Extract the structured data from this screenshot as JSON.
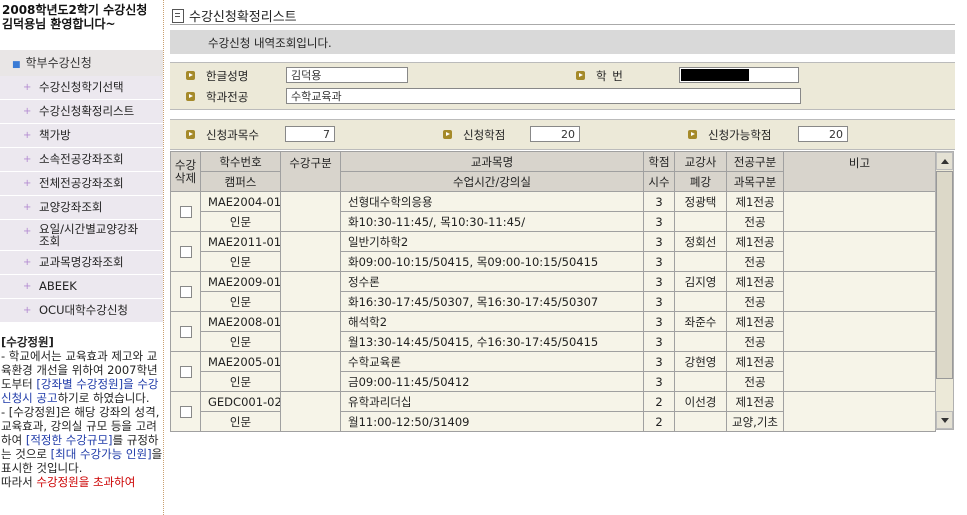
{
  "welcome": {
    "line1": "2008학년도2학기 수강신청",
    "line2": "김덕용님 환영합니다~"
  },
  "sidebar": {
    "main_item": "학부수강신청",
    "items": [
      {
        "label": "수강신청학기선택"
      },
      {
        "label": "수강신청확정리스트"
      },
      {
        "label": "책가방"
      },
      {
        "label": "소속전공강좌조회"
      },
      {
        "label": "전체전공강좌조회"
      },
      {
        "label": "교양강좌조회"
      },
      {
        "label": "요일/시간별교양강좌조회",
        "line1": "요일/시간별교양강좌",
        "line2": "조회"
      },
      {
        "label": "교과목명강좌조회"
      },
      {
        "label": "ABEEK"
      },
      {
        "label": "OCU대학수강신청"
      }
    ],
    "notice": {
      "title": "[수강정원]",
      "p1_a": "- 학교에서는 교육효과 제고와 교육환경 개선을 위하여 2007학년도부터 ",
      "p1_b": "[강좌별 수강정원]을 수강신청시 공고",
      "p1_c": "하기로 하였습니다.",
      "p2_a": "- [수강정원]은 해당 강좌의 성격, 교육효과, 강의실 규모 등을 고려하여 ",
      "p2_b": "[적정한 수강규모]",
      "p2_c": "를 규정하는 것으로 ",
      "p2_d": "[최대 수강가능 인원]",
      "p2_e": "을 표시한 것입니다.",
      "p3_a": "따라서 ",
      "p3_b": "수강정원을 초과하여"
    }
  },
  "main": {
    "title": "수강신청확정리스트",
    "info": "수강신청 내역조회입니다.",
    "student": {
      "name_label": "한글성명",
      "name_value": "김덕용",
      "id_label": "학 번",
      "major_label": "학과전공",
      "major_value": "수학교육과"
    },
    "summary": {
      "count_label": "신청과목수",
      "count_value": "7",
      "credits_label": "신청학점",
      "credits_value": "20",
      "max_label": "신청가능학점",
      "max_value": "20"
    }
  },
  "table": {
    "headers": {
      "del_a": "수강",
      "del_b": "삭제",
      "code": "학수번호",
      "campus": "캠퍼스",
      "type": "수강구분",
      "course_name": "교과목명",
      "schedule": "수업시간/강의실",
      "credit": "학점",
      "hours": "시수",
      "prof": "교강사",
      "closed": "폐강",
      "major_type": "전공구분",
      "subject_type": "과목구분",
      "note": "비고"
    },
    "rows": [
      {
        "code": "MAE2004-01",
        "campus": "인문",
        "name": "선형대수학의응용",
        "schedule": "화10:30-11:45/, 목10:30-11:45/",
        "credit": "3",
        "hours": "3",
        "prof": "정광택",
        "major_type": "제1전공",
        "subject_type": "전공"
      },
      {
        "code": "MAE2011-01",
        "campus": "인문",
        "name": "일반기하학2",
        "schedule": "화09:00-10:15/50415, 목09:00-10:15/50415",
        "credit": "3",
        "hours": "3",
        "prof": "정회선",
        "major_type": "제1전공",
        "subject_type": "전공"
      },
      {
        "code": "MAE2009-01",
        "campus": "인문",
        "name": "정수론",
        "schedule": "화16:30-17:45/50307, 목16:30-17:45/50307",
        "credit": "3",
        "hours": "3",
        "prof": "김지영",
        "major_type": "제1전공",
        "subject_type": "전공"
      },
      {
        "code": "MAE2008-01",
        "campus": "인문",
        "name": "해석학2",
        "schedule": "월13:30-14:45/50415, 수16:30-17:45/50415",
        "credit": "3",
        "hours": "3",
        "prof": "좌준수",
        "major_type": "제1전공",
        "subject_type": "전공"
      },
      {
        "code": "MAE2005-01",
        "campus": "인문",
        "name": "수학교육론",
        "schedule": "금09:00-11:45/50412",
        "credit": "3",
        "hours": "3",
        "prof": "강현영",
        "major_type": "제1전공",
        "subject_type": "전공"
      },
      {
        "code": "GEDC001-02",
        "campus": "인문",
        "name": "유학과리더십",
        "schedule": "월11:00-12:50/31409",
        "credit": "2",
        "hours": "2",
        "prof": "이선경",
        "major_type": "제1전공",
        "subject_type": "교양,기초"
      }
    ]
  }
}
